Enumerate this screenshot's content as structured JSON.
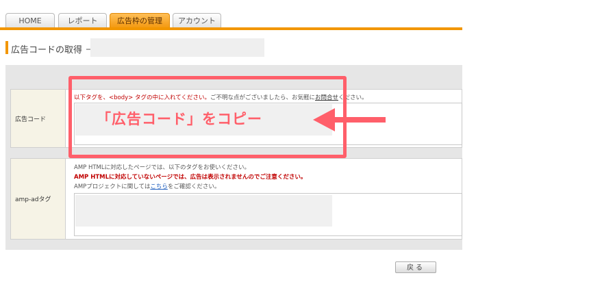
{
  "tabs": [
    {
      "label": "HOME",
      "active": false
    },
    {
      "label": "レポート",
      "active": false
    },
    {
      "label": "広告枠の管理",
      "active": true
    },
    {
      "label": "アカウント",
      "active": false
    }
  ],
  "page": {
    "title": "広告コードの取得 －",
    "title_field_value": ""
  },
  "ad_code": {
    "label": "広告コード",
    "instruction_red": "以下タグを、<body> タグの中に入れてください。",
    "instruction_rest": "ご不明な点がございましたら、お気軽に",
    "instruction_link": "お問合せ",
    "instruction_end": "ください。",
    "code_value": ""
  },
  "amp": {
    "label": "amp-adタグ",
    "line1": "AMP HTMLに対応したページでは、以下のタグをお使いください。",
    "warning": "AMP HTMLに対応していないページでは、広告は表示されませんのでご注意ください。",
    "line3_pre": "AMPプロジェクトに関しては",
    "line3_link": "こちら",
    "line3_post": "をご確認ください。",
    "code_value": ""
  },
  "annotation": {
    "text": "「広告コード」をコピー",
    "color": "#ff5f6a"
  },
  "buttons": {
    "back": "戻る"
  },
  "colors": {
    "accent": "#f29600",
    "warning": "#c00000"
  }
}
